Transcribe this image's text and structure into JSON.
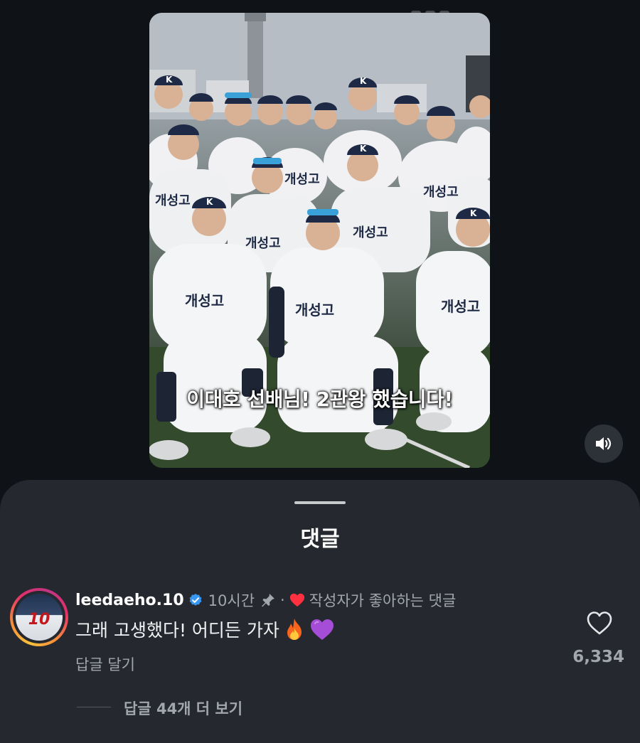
{
  "video": {
    "caption": "이대호 선배님! 2관왕 했습니다!",
    "jersey_text": "개성고",
    "cap_letter": "K"
  },
  "controls": {
    "sound_icon": "speaker-icon"
  },
  "comments_sheet": {
    "title": "댓글",
    "comment": {
      "username": "leedaeho.10",
      "avatar_number": "10",
      "time": "10시간",
      "separator": "·",
      "liked_by_creator": "작성자가 좋아하는 댓글",
      "text": "그래 고생했다! 어디든 가자",
      "emojis": [
        "fire",
        "purple-heart"
      ],
      "reply_label": "답글 달기",
      "like_count": "6,334"
    },
    "view_replies": "답글 44개 더 보기"
  },
  "colors": {
    "background": "#0f1216",
    "sheet": "#25282e",
    "muted_text": "#a2a6ad",
    "verified_blue": "#3897f0",
    "heart_red": "#ff3040"
  }
}
